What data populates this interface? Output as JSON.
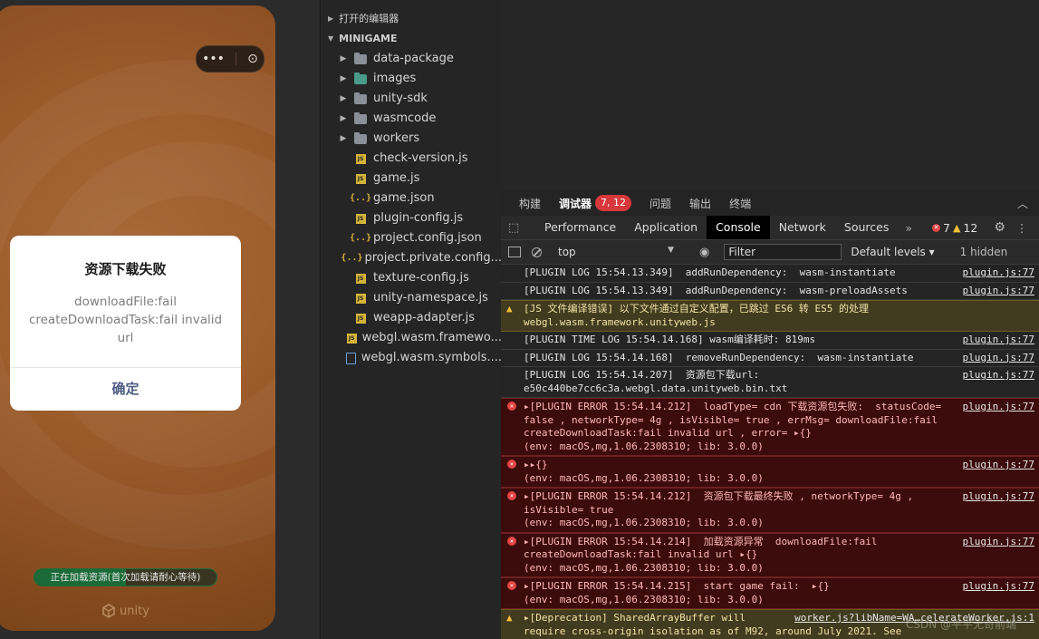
{
  "simulator": {
    "capsule_more": "•••",
    "capsule_close": "⊙",
    "dialog": {
      "title": "资源下载失败",
      "message": "downloadFile:fail createDownloadTask:fail invalid url",
      "confirm_label": "确定"
    },
    "loading": {
      "text": "正在加载资源(首次加载请耐心等待)",
      "progress": 0.5
    },
    "unity_label": "unity"
  },
  "tree": {
    "open_editors": "打开的编辑器",
    "project": "MINIGAME",
    "items": [
      {
        "name": "data-package",
        "type": "folder"
      },
      {
        "name": "images",
        "type": "folder-img"
      },
      {
        "name": "unity-sdk",
        "type": "folder"
      },
      {
        "name": "wasmcode",
        "type": "folder"
      },
      {
        "name": "workers",
        "type": "folder"
      },
      {
        "name": "check-version.js",
        "type": "js"
      },
      {
        "name": "game.js",
        "type": "js"
      },
      {
        "name": "game.json",
        "type": "json"
      },
      {
        "name": "plugin-config.js",
        "type": "js"
      },
      {
        "name": "project.config.json",
        "type": "json"
      },
      {
        "name": "project.private.config...",
        "type": "json"
      },
      {
        "name": "texture-config.js",
        "type": "js"
      },
      {
        "name": "unity-namespace.js",
        "type": "js"
      },
      {
        "name": "weapp-adapter.js",
        "type": "js"
      },
      {
        "name": "webgl.wasm.framewo...",
        "type": "js"
      },
      {
        "name": "webgl.wasm.symbols....",
        "type": "txt"
      }
    ]
  },
  "devtools": {
    "top_tabs": [
      "构建",
      "调试器",
      "问题",
      "输出",
      "终端"
    ],
    "debugger_badge": "7, 12",
    "panel_tabs": [
      "Performance",
      "Application",
      "Console",
      "Network",
      "Sources"
    ],
    "more_tabs": "»",
    "error_count": "7",
    "warning_count": "12",
    "toolbar": {
      "context": "top",
      "filter_placeholder": "Filter",
      "levels": "Default levels ▾",
      "hidden": "1 hidden"
    },
    "logs": [
      {
        "level": "log",
        "text": "[PLUGIN LOG 15:54.13.349]  addRunDependency:  wasm-instantiate",
        "src": "plugin.js:77"
      },
      {
        "level": "log",
        "text": "[PLUGIN LOG 15:54.13.349]  addRunDependency:  wasm-preloadAssets",
        "src": "plugin.js:77"
      },
      {
        "level": "warn",
        "text": "[JS 文件编译错误] 以下文件通过自定义配置，已跳过 ES6 转 ES5 的处理\nwebgl.wasm.framework.unityweb.js",
        "src": ""
      },
      {
        "level": "log",
        "text": "[PLUGIN TIME LOG 15:54.14.168] wasm编译耗时: 819ms",
        "src": "plugin.js:77"
      },
      {
        "level": "log",
        "text": "[PLUGIN LOG 15:54.14.168]  removeRunDependency:  wasm-instantiate",
        "src": "plugin.js:77"
      },
      {
        "level": "log",
        "text": "[PLUGIN LOG 15:54.14.207]  资源包下载url:\ne50c440be7cc6c3a.webgl.data.unityweb.bin.txt",
        "src": "plugin.js:77"
      },
      {
        "level": "error",
        "text": "▸[PLUGIN ERROR 15:54.14.212]  loadType= cdn 下载资源包失败:  statusCode=\nfalse , networkType= 4g , isVisible= true , errMsg= downloadFile:fail\ncreateDownloadTask:fail invalid url , error= ▸{}\n(env: macOS,mg,1.06.2308310; lib: 3.0.0)",
        "src": "plugin.js:77"
      },
      {
        "level": "error",
        "text": "▸▸{}\n(env: macOS,mg,1.06.2308310; lib: 3.0.0)",
        "src": "plugin.js:77"
      },
      {
        "level": "error",
        "text": "▸[PLUGIN ERROR 15:54.14.212]  资源包下载最终失败 , networkType= 4g ,\nisVisible= true\n(env: macOS,mg,1.06.2308310; lib: 3.0.0)",
        "src": "plugin.js:77"
      },
      {
        "level": "error",
        "text": "▸[PLUGIN ERROR 15:54.14.214]  加载资源异常  downloadFile:fail\ncreateDownloadTask:fail invalid url ▸{}\n(env: macOS,mg,1.06.2308310; lib: 3.0.0)",
        "src": "plugin.js:77"
      },
      {
        "level": "error",
        "text": "▸[PLUGIN ERROR 15:54.14.215]  start game fail:  ▸{}\n(env: macOS,mg,1.06.2308310; lib: 3.0.0)",
        "src": "plugin.js:77"
      },
      {
        "level": "warn",
        "text": "▸[Deprecation] SharedArrayBuffer will        \nrequire cross-origin isolation as of M92, around July 2021. See https://developer.chro\nme.com/blog/enabling-shared-array-buffer/ for more details.",
        "src": "worker.js?libName=WA…celerateWorker.js:1"
      }
    ]
  },
  "watermark": "CSDN @平平无奇前端",
  "colors": {
    "error_bg": "#3c0b0b",
    "warn_bg": "#413b1f",
    "badge": "#d8373b",
    "console_tab": "#000000"
  }
}
